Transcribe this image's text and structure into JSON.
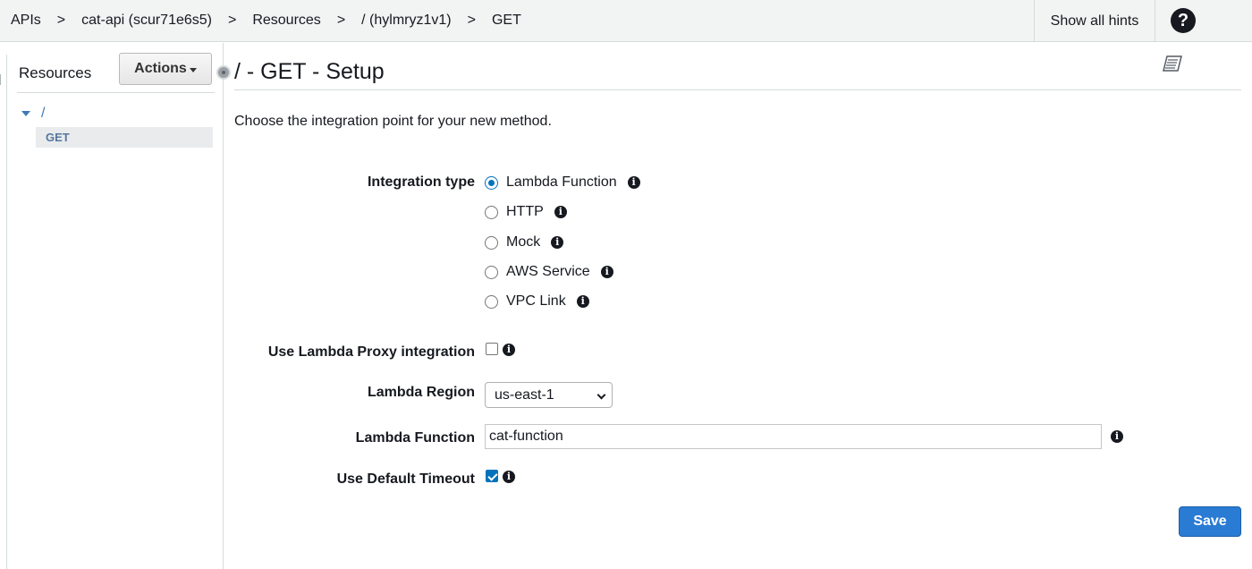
{
  "breadcrumb": {
    "items": [
      "APIs",
      "cat-api (scur71e6s5)",
      "Resources",
      "/ (hylmryz1v1)",
      "GET"
    ],
    "separator": ">"
  },
  "header": {
    "hints_label": "Show all hints",
    "help_glyph": "?"
  },
  "sidebar": {
    "title": "Resources",
    "actions_label": "Actions",
    "tree": {
      "root_label": "/",
      "child_label": "GET"
    }
  },
  "main": {
    "title": "/ - GET - Setup",
    "intro": "Choose the integration point for your new method.",
    "integration_type": {
      "label": "Integration type",
      "options": [
        "Lambda Function",
        "HTTP",
        "Mock",
        "AWS Service",
        "VPC Link"
      ],
      "selected": "Lambda Function"
    },
    "proxy": {
      "label": "Use Lambda Proxy integration",
      "checked": false
    },
    "region": {
      "label": "Lambda Region",
      "value": "us-east-1"
    },
    "function": {
      "label": "Lambda Function",
      "value": "cat-function"
    },
    "timeout": {
      "label": "Use Default Timeout",
      "checked": true
    },
    "save_label": "Save"
  },
  "colors": {
    "accent": "#0073bb",
    "save_button": "#2a7bd3",
    "tree_link": "#3f7ab5"
  },
  "icons": {
    "info": "info-icon",
    "help": "help-icon",
    "doc": "documentation-icon"
  }
}
